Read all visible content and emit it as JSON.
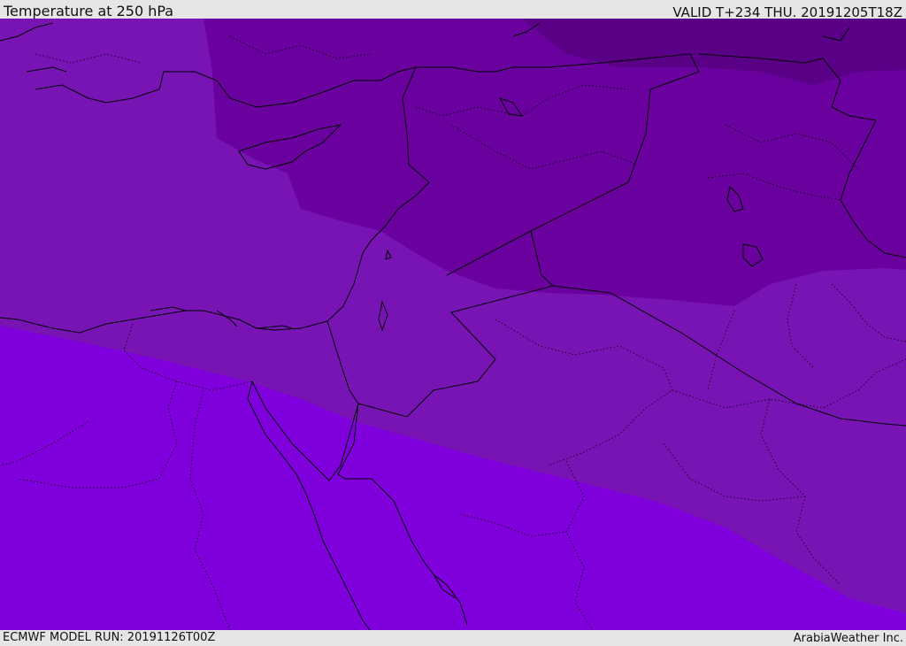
{
  "header": {
    "title": "Temperature at 250 hPa",
    "valid": "VALID T+234 THU. 20191205T18Z"
  },
  "footer": {
    "model_run": "ECMWF MODEL RUN: 20191126T00Z",
    "credit": "ArabiaWeather Inc."
  },
  "colors": {
    "band_darkest": "#5a0086",
    "band_dark": "#6a009e",
    "band_mid": "#7813b4",
    "band_light": "#7f00dd",
    "coastline": "#000000"
  }
}
